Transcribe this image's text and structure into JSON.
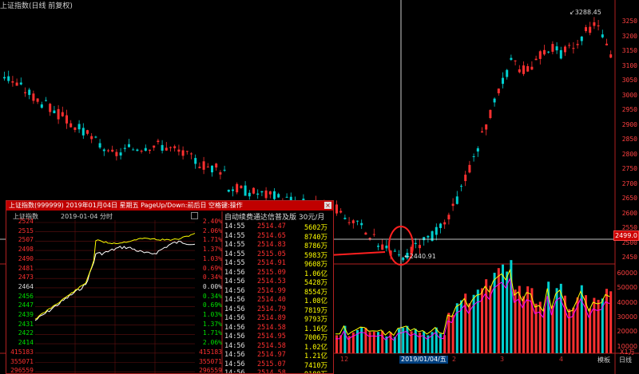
{
  "window": {
    "title": "上证指数(日线 前复权)"
  },
  "price_axis": [
    "3250",
    "3200",
    "3150",
    "3100",
    "3050",
    "3000",
    "2950",
    "2900",
    "2850",
    "2800",
    "2750",
    "2700",
    "2650",
    "2600",
    "2550",
    "2500",
    "2450"
  ],
  "volume_axis": [
    "60000",
    "50000",
    "40000",
    "30000",
    "20000",
    "10000"
  ],
  "volume_axis_unit": "X1万",
  "current_price_tag": "2499.0",
  "high_label": "3288.45",
  "low_label": "2440.91",
  "crosshair_date": "2019/01/04/五",
  "timeline": [
    "12",
    "2",
    "3",
    "4"
  ],
  "mode_labels": {
    "left": "模板",
    "right": "日线"
  },
  "popup": {
    "header": "上证指数(999999) 2019年01月04日 星期五 PageUp/Down:前后日 空格键:操作",
    "close": "×",
    "subchart_title": "上证指数",
    "subchart_date": "2019-01-04 分时",
    "left_prices": [
      "2524",
      "2515",
      "2507",
      "2498",
      "2490",
      "2481",
      "2473",
      "2464",
      "2456",
      "2447",
      "2439",
      "2431",
      "2422",
      "2414",
      "415183",
      "355071",
      "296559"
    ],
    "right_pcts": [
      "2.40%",
      "2.06%",
      "1.71%",
      "1.37%",
      "1.03%",
      "0.69%",
      "0.34%",
      "0.00%",
      "0.34%",
      "0.69%",
      "1.03%",
      "1.37%",
      "1.71%",
      "2.06%",
      "415183",
      "355071",
      "296559"
    ],
    "tick_header": "自动续费通达信普及版   30元/月",
    "ticks": [
      {
        "time": "14:55",
        "price": "2514.47",
        "vol": "5602万"
      },
      {
        "time": "14:55",
        "price": "2514.65",
        "vol": "8740万"
      },
      {
        "time": "14:55",
        "price": "2514.83",
        "vol": "8786万"
      },
      {
        "time": "14:55",
        "price": "2515.05",
        "vol": "5983万"
      },
      {
        "time": "14:55",
        "price": "2514.91",
        "vol": "9608万"
      },
      {
        "time": "14:56",
        "price": "2515.09",
        "vol": "1.06亿"
      },
      {
        "time": "14:56",
        "price": "2514.53",
        "vol": "5428万"
      },
      {
        "time": "14:56",
        "price": "2514.99",
        "vol": "8554万"
      },
      {
        "time": "14:56",
        "price": "2514.40",
        "vol": "1.08亿"
      },
      {
        "time": "14:56",
        "price": "2514.79",
        "vol": "7819万"
      },
      {
        "time": "14:56",
        "price": "2514.89",
        "vol": "9793万"
      },
      {
        "time": "14:56",
        "price": "2514.58",
        "vol": "1.16亿"
      },
      {
        "time": "14:56",
        "price": "2514.95",
        "vol": "7006万"
      },
      {
        "time": "14:56",
        "price": "2514.58",
        "vol": "1.02亿"
      },
      {
        "time": "14:56",
        "price": "2514.97",
        "vol": "1.21亿"
      },
      {
        "time": "14:56",
        "price": "2515.07",
        "vol": "7410万"
      },
      {
        "time": "14:56",
        "price": "2514.58",
        "vol": "9188万"
      },
      {
        "time": "14:57",
        "price": "2515.09",
        "vol": "7342万"
      }
    ]
  },
  "colors": {
    "up": "#ff3030",
    "down": "#00d0d0",
    "axis": "#b02020",
    "ma": "#ffff00",
    "ma2": "#ff00ff"
  }
}
